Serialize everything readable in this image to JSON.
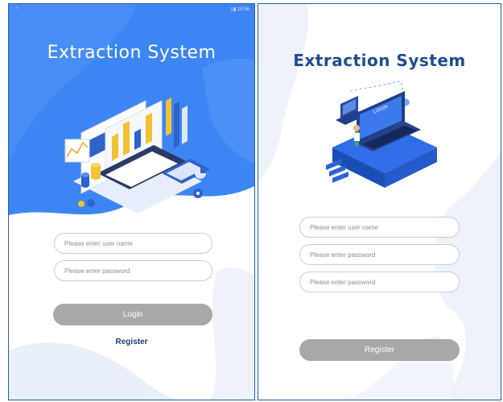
{
  "left_screen": {
    "status": {
      "wifi_icon": "wifi-icon",
      "right_text": "▯▮ 19:56"
    },
    "title": "Extraction System",
    "username_placeholder": "Please enter user name",
    "password_placeholder": "Please enter password",
    "login_label": "Login",
    "register_link": "Register",
    "colors": {
      "header_blue": "#3d85f2",
      "button_gray": "#a8a8a8"
    }
  },
  "right_screen": {
    "title": "Extraction System",
    "username_placeholder": "Please enter user name",
    "password_placeholder": "Please enter password",
    "confirm_password_placeholder": "Please enter password",
    "laptop_screen_text": "LOGIN",
    "register_label": "Register",
    "colors": {
      "title_blue": "#1f4e8e",
      "button_gray": "#a8a8a8"
    }
  }
}
